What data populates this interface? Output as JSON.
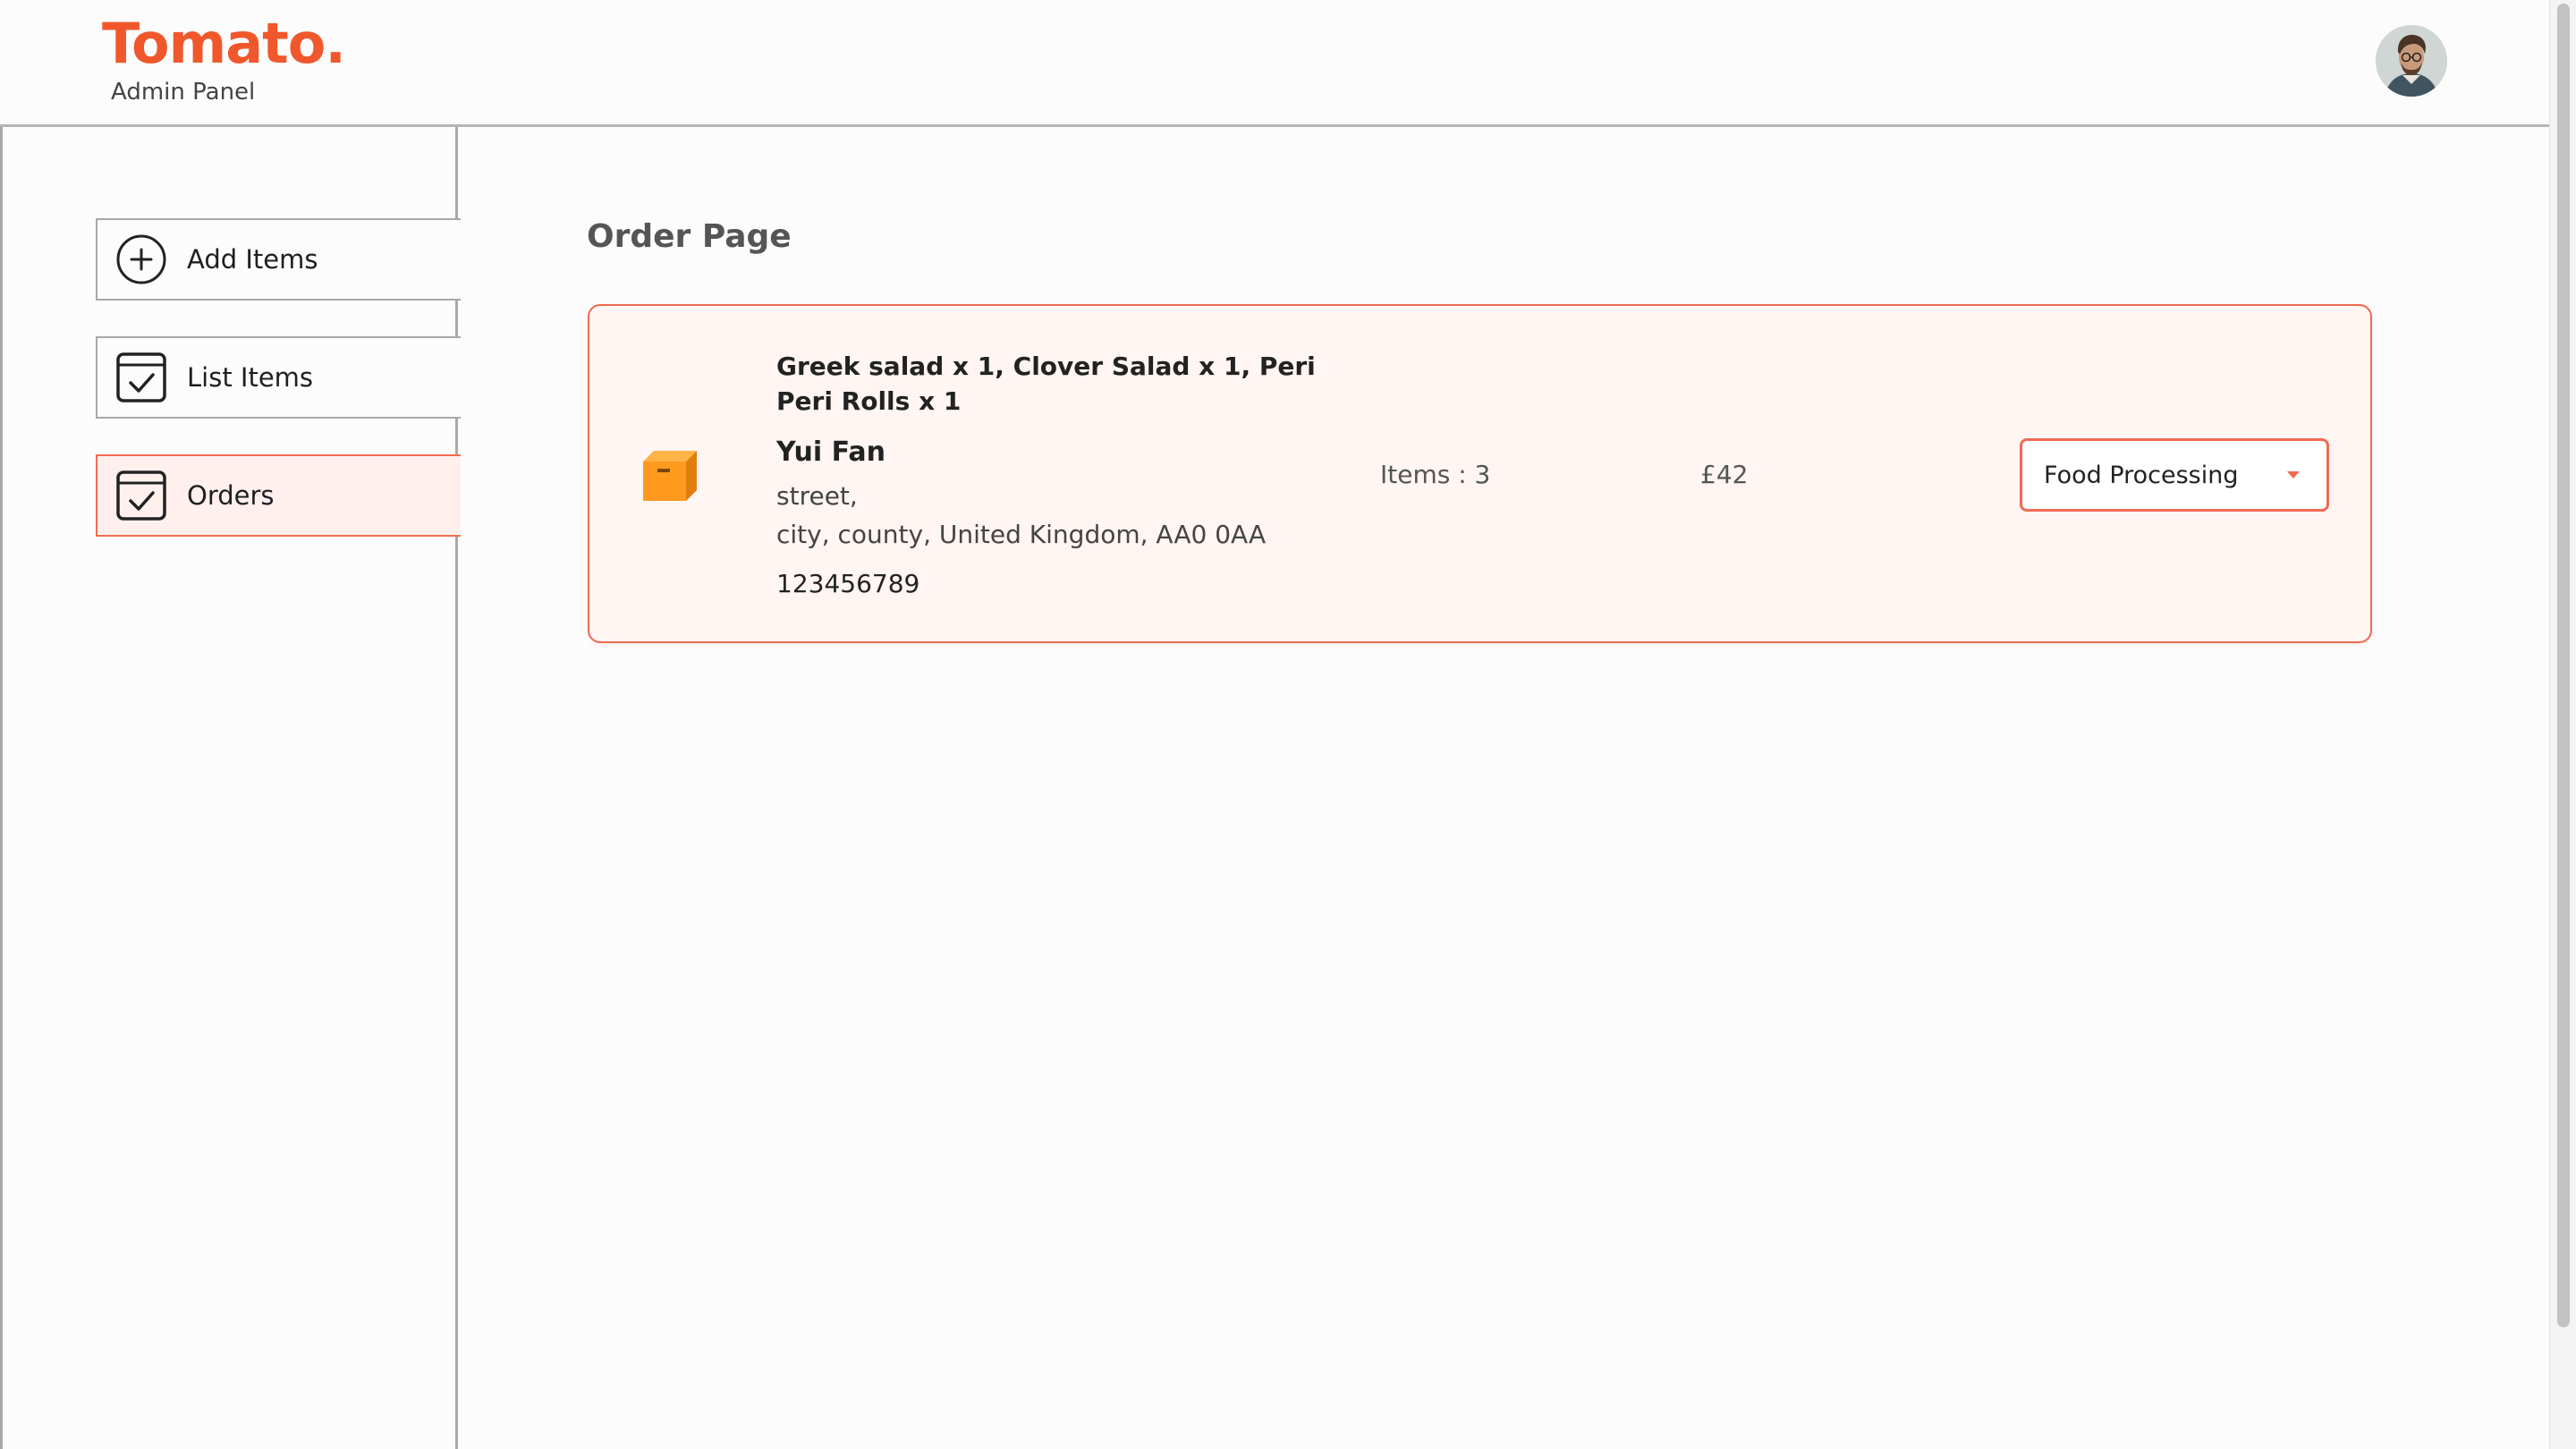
{
  "header": {
    "logo_text": "Tomato.",
    "logo_subtitle": "Admin Panel",
    "avatar_icon": "user-avatar"
  },
  "sidebar": {
    "items": [
      {
        "label": "Add Items",
        "icon": "plus-circle-icon",
        "active": false
      },
      {
        "label": "List Items",
        "icon": "checkbox-icon",
        "active": false
      },
      {
        "label": "Orders",
        "icon": "checkbox-icon",
        "active": true
      }
    ]
  },
  "main": {
    "title": "Order Page",
    "orders": [
      {
        "icon": "parcel-icon",
        "items_text": "Greek salad x 1, Clover Salad x 1, Peri Peri Rolls x 1",
        "customer_name": "Yui Fan",
        "address_line1": "street,",
        "address_line2": "city, county, United Kingdom, AA0 0AA",
        "phone": "123456789",
        "items_count": "Items : 3",
        "amount": "£42",
        "status": "Food Processing"
      }
    ]
  },
  "colors": {
    "brand": "#f0582c",
    "accent_border": "#f06a52",
    "active_bg": "#fff0ee",
    "card_bg": "#fff5f3"
  }
}
